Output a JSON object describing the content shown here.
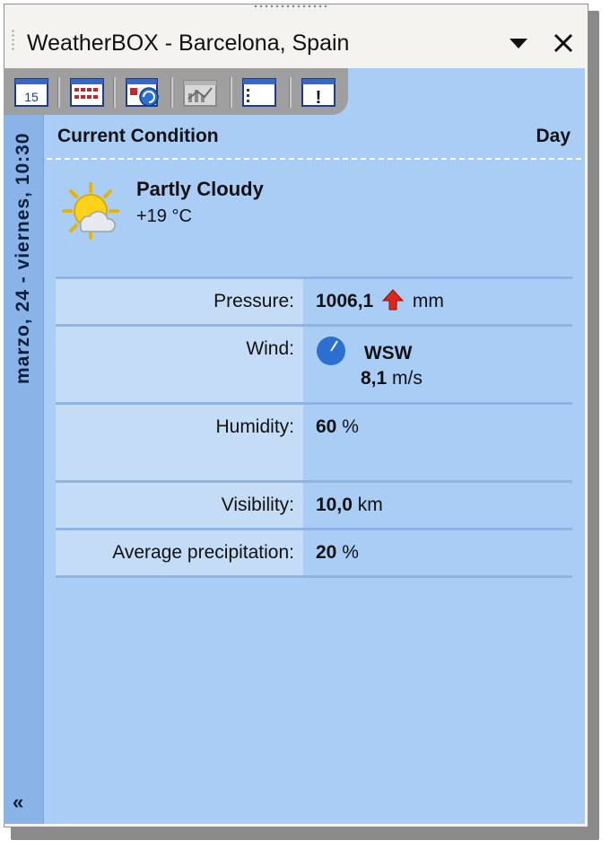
{
  "window": {
    "title": "WeatherBOX - Barcelona, Spain"
  },
  "toolbar": {
    "buttons": [
      {
        "name": "calendar-15-icon",
        "label": "15"
      },
      {
        "name": "calendar-grid-icon"
      },
      {
        "name": "refresh-calendar-icon"
      },
      {
        "name": "chart-icon"
      },
      {
        "name": "list-icon"
      },
      {
        "name": "alert-icon",
        "label": "!"
      }
    ]
  },
  "sidebar": {
    "date_text": "marzo, 24 - viernes, 10:30",
    "collapse_label": "«"
  },
  "header": {
    "title": "Current Condition",
    "period": "Day"
  },
  "current": {
    "condition": "Partly Cloudy",
    "temperature": "+19 °C",
    "icon": "partly-cloudy-icon"
  },
  "details": {
    "pressure": {
      "label": "Pressure:",
      "value": "1006,1",
      "unit": "mm",
      "trend": "up"
    },
    "wind": {
      "label": "Wind:",
      "direction": "WSW",
      "speed": "8,1",
      "unit": "m/s"
    },
    "humidity": {
      "label": "Humidity:",
      "value": "60",
      "unit": "%"
    },
    "visibility": {
      "label": "Visibility:",
      "value": "10,0",
      "unit": "km"
    },
    "precipitation": {
      "label": "Average precipitation:",
      "value": "20",
      "unit": "%"
    }
  },
  "colors": {
    "panel": "#a9cdf5",
    "label_bg": "#c5dcf6",
    "sidebar": "#8ab4e8",
    "toolbar": "#9f9f9f",
    "pressure_arrow": "#e0261a",
    "wind_dial": "#2b6fd1"
  }
}
